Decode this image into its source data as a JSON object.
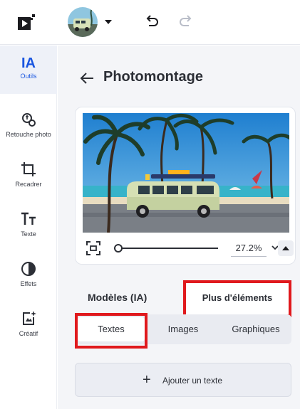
{
  "topbar": {
    "logo_icon": "play-logo-icon",
    "avatar_icon": "project-thumbnail",
    "avatar_caret_icon": "caret-down-icon",
    "undo_icon": "undo-icon",
    "redo_icon": "redo-icon"
  },
  "rail": {
    "items": [
      {
        "glyph": "IA",
        "label": "Outils",
        "icon": "ai-icon",
        "active": true
      },
      {
        "label": "Retouche photo",
        "icon": "photo-retouch-icon"
      },
      {
        "label": "Recadrer",
        "icon": "crop-icon"
      },
      {
        "label": "Texte",
        "icon": "text-icon"
      },
      {
        "label": "Effets",
        "icon": "effects-icon"
      },
      {
        "label": "Créatif",
        "icon": "creative-icon"
      }
    ]
  },
  "header": {
    "title": "Photomontage",
    "back_icon": "arrow-left-icon"
  },
  "preview": {
    "zoom": "27.2%",
    "zoom_fraction": 0.03,
    "fit_icon": "fit-screen-icon",
    "zoom_dropdown_icon": "chevron-down-icon",
    "collapse_icon": "caret-up-icon"
  },
  "tabs": {
    "models": "Modèles (IA)",
    "more": "Plus d'éléments"
  },
  "segments": [
    "Textes",
    "Images",
    "Graphiques"
  ],
  "segment_active": "Textes",
  "add_text": {
    "label": "Ajouter un texte",
    "plus": "+"
  },
  "colors": {
    "accent": "#1a56e0",
    "highlight": "#e0191d",
    "panel_bg": "#f4f5f8"
  }
}
